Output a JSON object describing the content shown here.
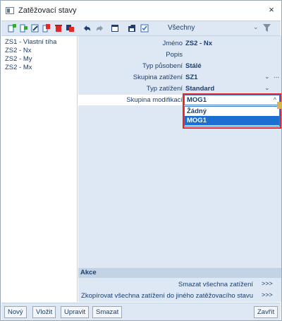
{
  "window": {
    "title": "Zatěžovací stavy",
    "close_glyph": "×"
  },
  "toolbar": {
    "icons": [
      "new-icon",
      "insert-icon",
      "edit-icon",
      "copy-icon",
      "delete-icon",
      "duplicate-icon",
      "undo-icon",
      "redo-icon",
      "table-icon",
      "save-icon",
      "check-icon"
    ],
    "filter_label": "Všechny",
    "filter_chevron": "⌄",
    "funnel_icon": "funnel-icon"
  },
  "load_cases": {
    "items": [
      {
        "label": "ZS1 - Vlastní tíha"
      },
      {
        "label": "ZS2 - Nx"
      },
      {
        "label": "ZS2 - My"
      },
      {
        "label": "ZS2 - Mx"
      }
    ],
    "selected_index": 1
  },
  "properties": {
    "name": {
      "label": "Jméno",
      "value": "ZS2 - Nx"
    },
    "description": {
      "label": "Popis",
      "value": ""
    },
    "action_type": {
      "label": "Typ působení",
      "value": "Stálé"
    },
    "load_group": {
      "label": "Skupina zatížení",
      "value": "SZ1",
      "chevron": "⌄",
      "more": "..."
    },
    "load_type": {
      "label": "Typ zatížení",
      "value": "Standard",
      "chevron": "⌄"
    },
    "modification_group": {
      "label": "Skupina modifikací",
      "value": "MOG1",
      "chevron_up": "^"
    }
  },
  "dropdown": {
    "options": [
      "Žádný",
      "MOG1"
    ],
    "selected_index": 1,
    "highlight_color": "#e0282b"
  },
  "actions": {
    "header": "Akce",
    "items": [
      {
        "label": "Smazat všechna zatížení",
        "go": ">>>"
      },
      {
        "label": "Zkopírovat všechna zatížení do jiného zatěžovacího stavu",
        "go": ">>>"
      }
    ]
  },
  "buttons": {
    "new": "Nový",
    "insert": "Vložit",
    "edit": "Upravit",
    "delete": "Smazat",
    "close": "Zavřít"
  },
  "colors": {
    "panel_bg": "#dde8f4",
    "text_blue": "#1c3f6e",
    "selection_blue": "#1a6fd1"
  }
}
